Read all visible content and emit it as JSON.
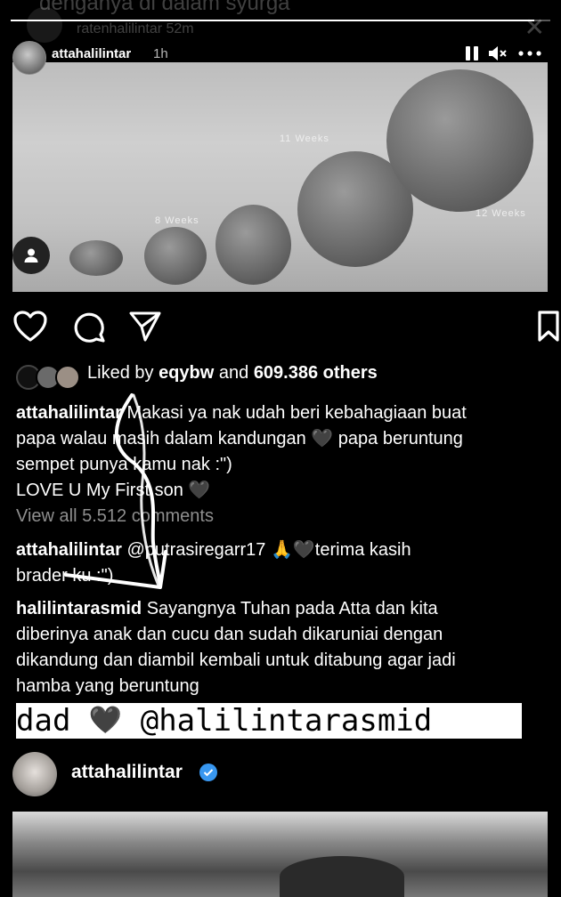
{
  "ghost": {
    "line": "denganya di dalam syurga",
    "user": "ratenhalilintar 52m"
  },
  "story": {
    "username": "attahalilintar",
    "time": "1h",
    "progress": 0.97
  },
  "image": {
    "labels": [
      "11 Weeks",
      "8 Weeks",
      "12 Weeks"
    ]
  },
  "post": {
    "liked_prefix": "Liked by",
    "liked_user": "eqybw",
    "liked_and": "and",
    "liked_count": "609.386 others",
    "caption_user": "attahalilintar",
    "caption_line1": "Makasi ya nak udah beri kebahagiaan buat",
    "caption_line2": "papa walau masih dalam kandungan 🖤 papa beruntung",
    "caption_line3": "sempet punya kamu nak :\")",
    "caption_line4": "LOVE U My First son 🖤",
    "view_all": "View all 5.512 comments",
    "comments": [
      {
        "user": "attahalilintar",
        "mention": "@putrasiregarr17",
        "text_line1": "🙏🖤terima kasih",
        "text_line2": "brader ku :\")"
      },
      {
        "user": "halilintarasmid",
        "text_line1": "Sayangnya Tuhan pada Atta dan kita",
        "text_line2": "diberinya anak dan cucu dan sudah dikaruniai dengan",
        "text_line3": "dikandung dan diambil kembali untuk ditabung agar jadi",
        "text_line4": "hamba yang beruntung"
      }
    ]
  },
  "band": {
    "text_left": "dad ",
    "heart": "🖤",
    "text_right": " @halilintarasmid"
  },
  "bottom": {
    "username": "attahalilintar"
  },
  "colors": {
    "verified": "#3897f0",
    "muted": "#8e8e8e"
  }
}
